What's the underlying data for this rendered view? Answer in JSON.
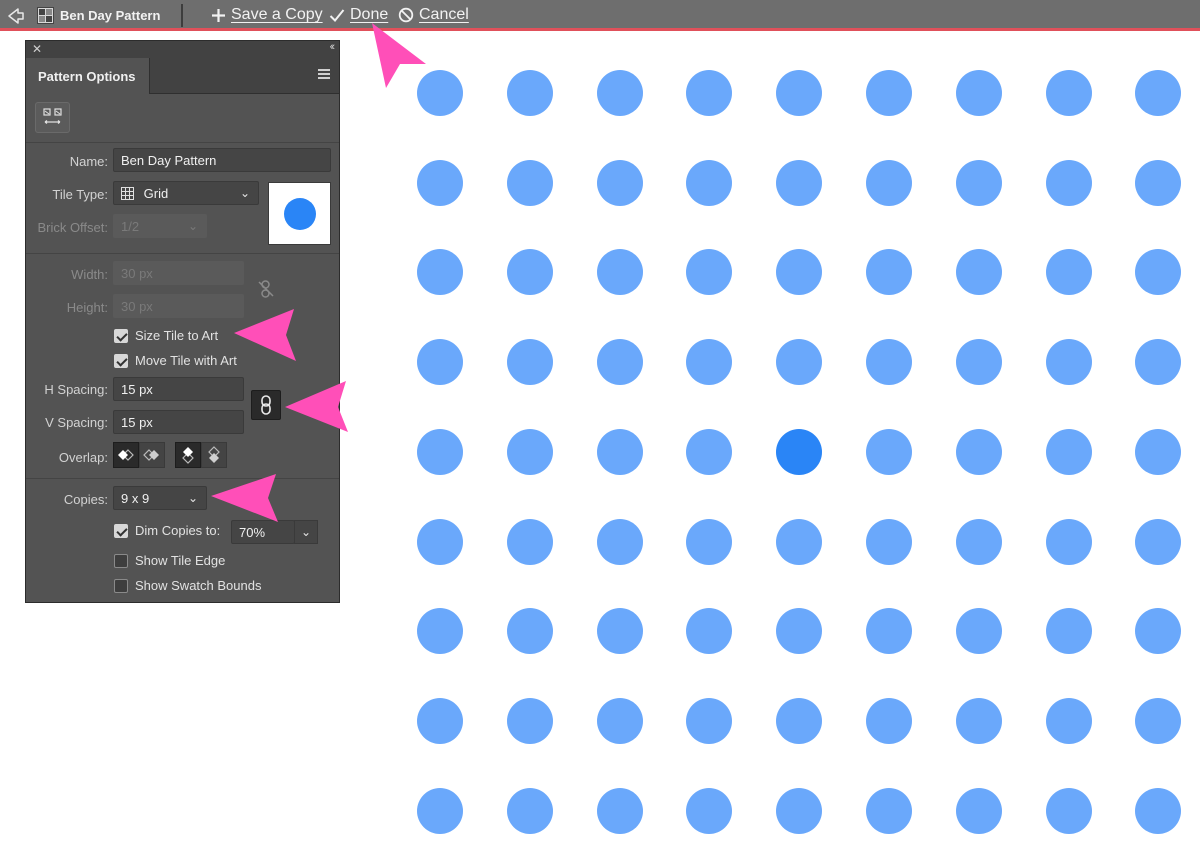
{
  "toolbar": {
    "title": "Ben Day Pattern",
    "save_copy_label": "Save a Copy",
    "done_label": "Done",
    "cancel_label": "Cancel",
    "accent_color": "#e0505a"
  },
  "panel": {
    "tab_label": "Pattern Options",
    "name": {
      "label": "Name:",
      "value": "Ben Day Pattern"
    },
    "tile_type": {
      "label": "Tile Type:",
      "value": "Grid"
    },
    "brick_offset": {
      "label": "Brick Offset:",
      "value": "1/2"
    },
    "width": {
      "label": "Width:",
      "value": "30 px"
    },
    "height": {
      "label": "Height:",
      "value": "30 px"
    },
    "size_tile_to_art": {
      "label": "Size Tile to Art",
      "checked": true
    },
    "move_tile_with_art": {
      "label": "Move Tile with Art",
      "checked": true
    },
    "h_spacing": {
      "label": "H Spacing:",
      "value": "15 px"
    },
    "v_spacing": {
      "label": "V Spacing:",
      "value": "15 px"
    },
    "overlap": {
      "label": "Overlap:"
    },
    "copies": {
      "label": "Copies:",
      "value": "9 x 9"
    },
    "dim_copies": {
      "label": "Dim Copies to:",
      "value": "70%",
      "checked": true
    },
    "show_tile_edge": {
      "label": "Show Tile Edge",
      "checked": false
    },
    "show_swatch_bounds": {
      "label": "Show Swatch Bounds",
      "checked": false
    }
  },
  "canvas": {
    "rows": 9,
    "cols": 9,
    "original_row": 4,
    "original_col": 4,
    "original_color": "#2a85f6",
    "copy_color": "#6aa8fb"
  },
  "annotation_color": "#ff4fb8"
}
